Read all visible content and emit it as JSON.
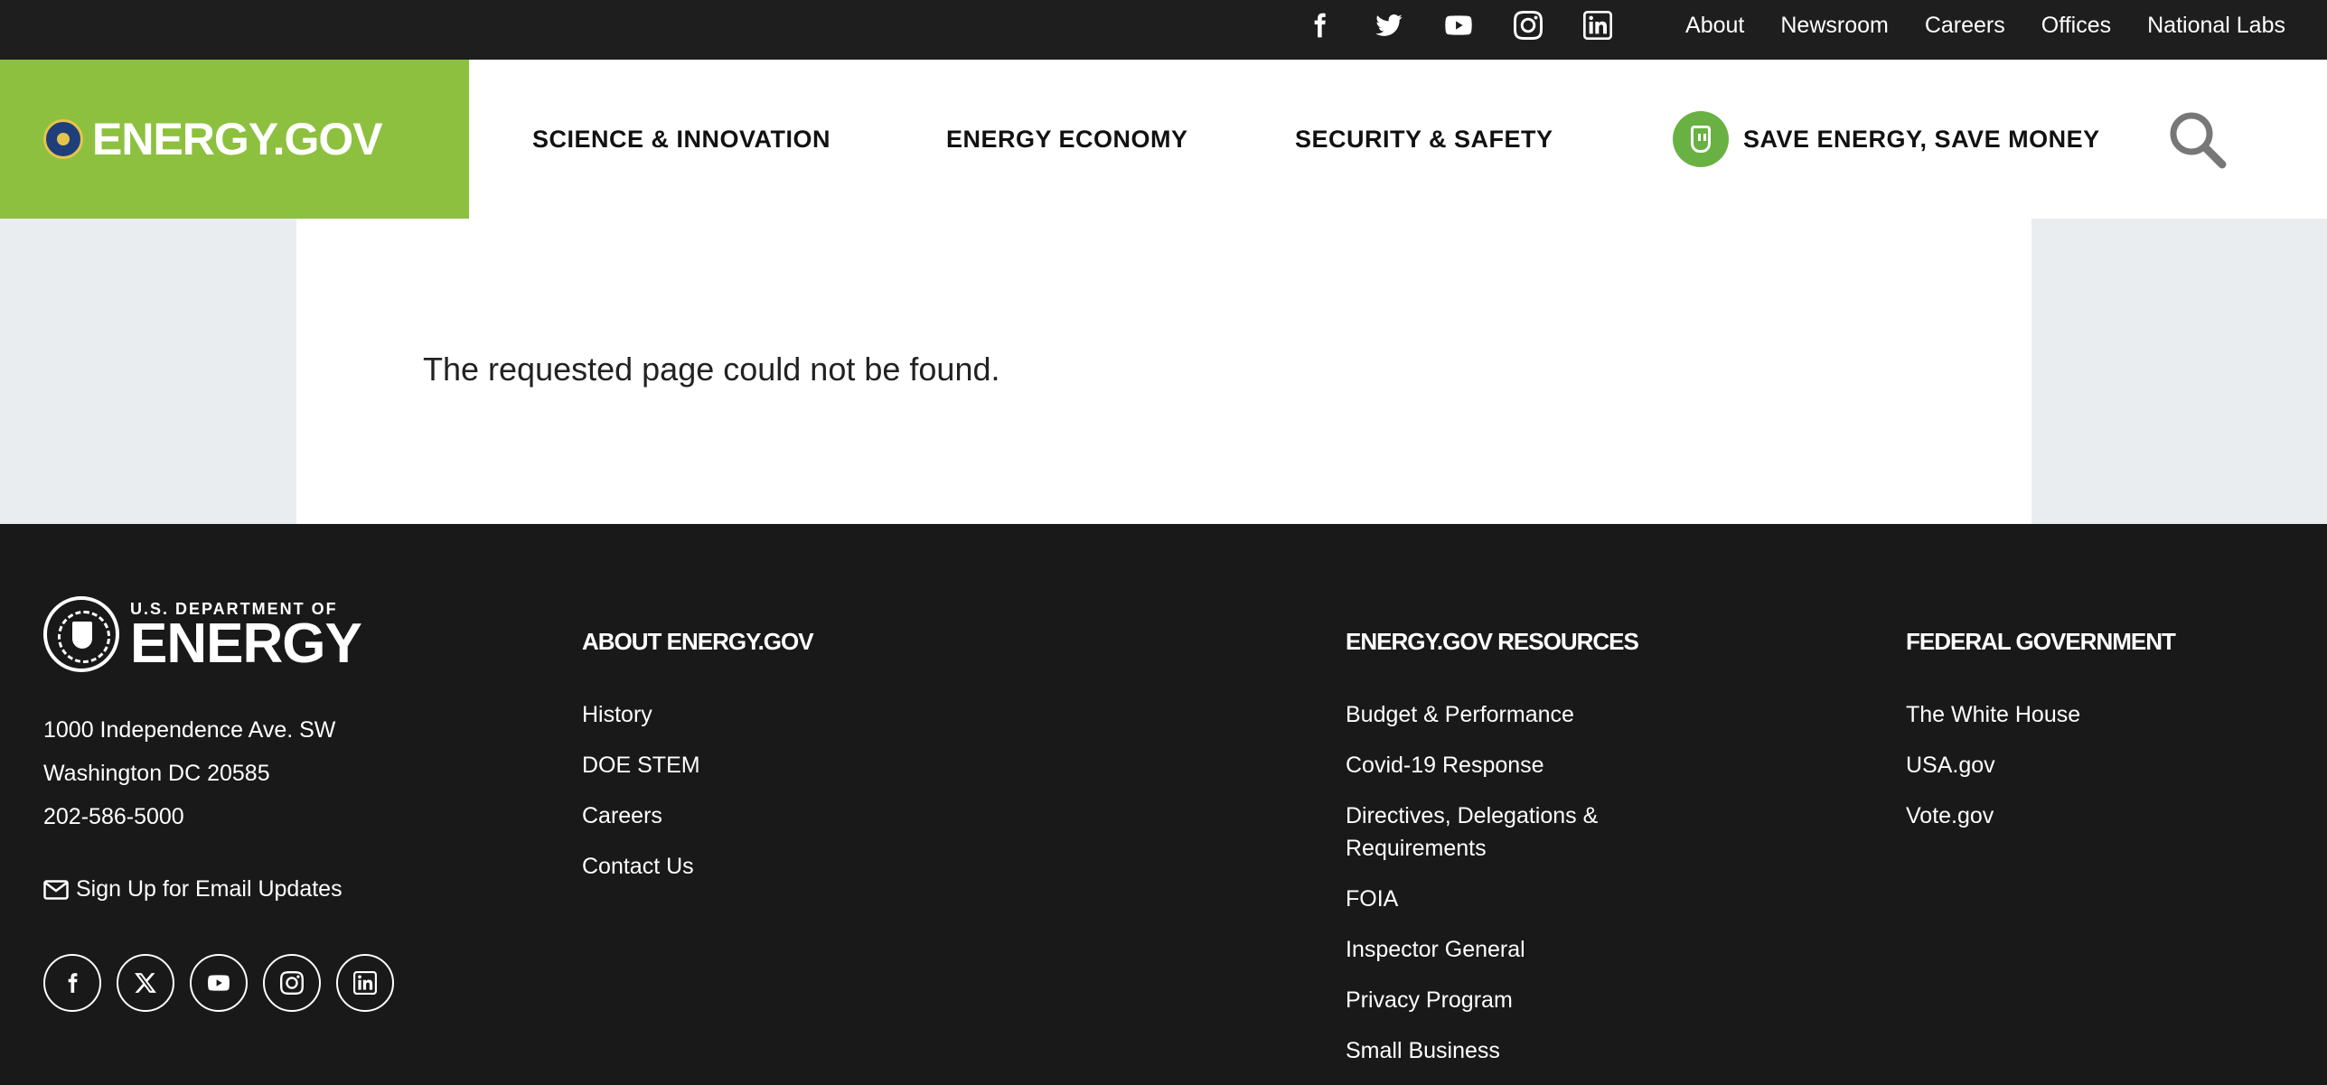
{
  "utility": {
    "social_icons": [
      "facebook-icon",
      "twitter-icon",
      "youtube-icon",
      "instagram-icon",
      "linkedin-icon"
    ],
    "links": [
      "About",
      "Newsroom",
      "Careers",
      "Offices",
      "National Labs"
    ]
  },
  "header": {
    "logo_text": "ENERGY.GOV",
    "nav": {
      "science": "SCIENCE & INNOVATION",
      "economy": "ENERGY ECONOMY",
      "security": "SECURITY & SAFETY",
      "save": "SAVE ENERGY, SAVE MONEY"
    }
  },
  "content": {
    "message": "The requested page could not be found."
  },
  "footer": {
    "logo_small": "U.S. DEPARTMENT OF",
    "logo_big": "ENERGY",
    "address_line1": "1000 Independence Ave. SW",
    "address_line2": "Washington DC 20585",
    "phone": "202-586-5000",
    "email_updates": "Sign Up for Email Updates",
    "social_icons": [
      "facebook-icon",
      "x-icon",
      "youtube-icon",
      "instagram-icon",
      "linkedin-icon"
    ],
    "about": {
      "heading": "ABOUT ENERGY.GOV",
      "items": [
        "History",
        "DOE STEM",
        "Careers",
        "Contact Us"
      ]
    },
    "resources": {
      "heading": "ENERGY.GOV RESOURCES",
      "items": [
        "Budget & Performance",
        "Covid-19 Response",
        "Directives, Delegations & Requirements",
        "FOIA",
        "Inspector General",
        "Privacy Program",
        "Small Business"
      ]
    },
    "federal": {
      "heading": "FEDERAL GOVERNMENT",
      "items": [
        "The White House",
        "USA.gov",
        "Vote.gov"
      ]
    }
  },
  "colors": {
    "brand_green": "#8dc03e",
    "save_green": "#6ab144",
    "dark_bar": "#1e1e1e",
    "footer_bg": "#191919",
    "content_bg": "#eaedf0"
  }
}
